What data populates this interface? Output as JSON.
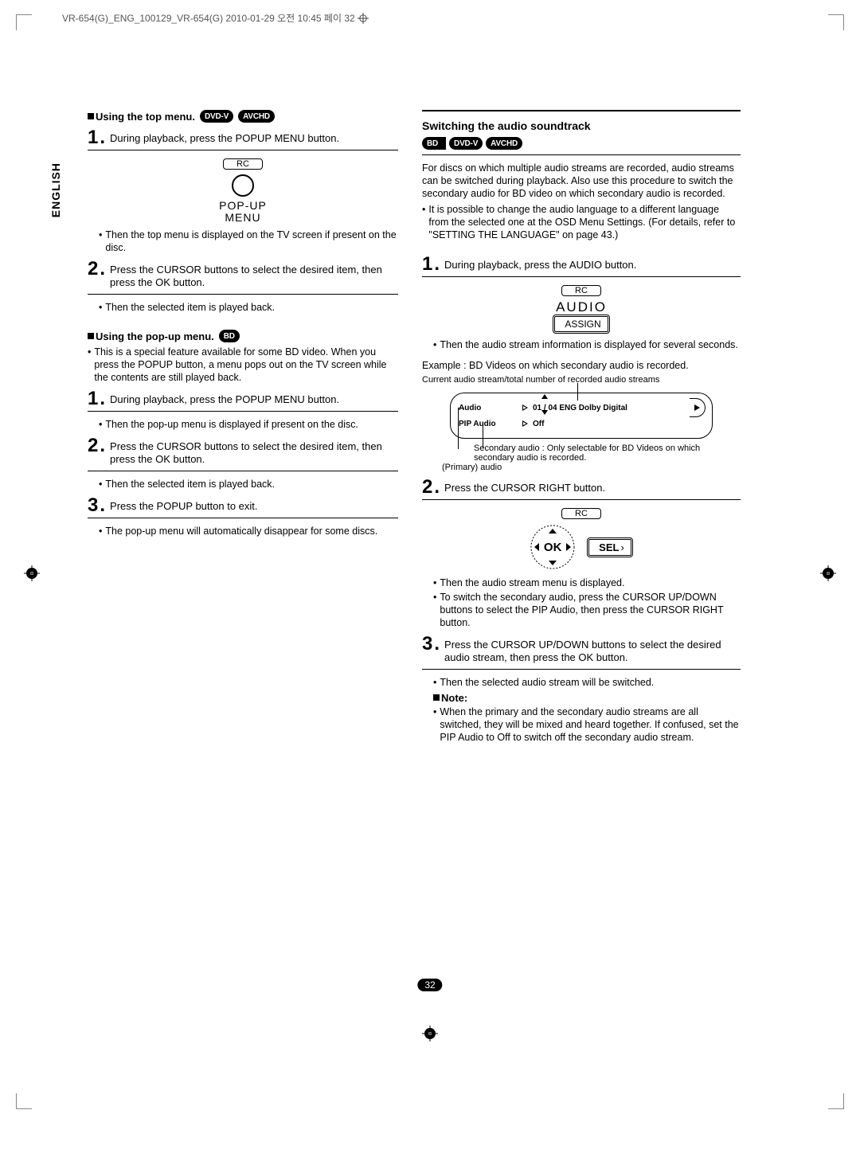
{
  "header": "VR-654(G)_ENG_100129_VR-654(G)  2010-01-29  오전 10:45  페이   32",
  "lang_tab": "ENGLISH",
  "page_number": "32",
  "pills": {
    "bd": "BD",
    "dvdv": "DVD-V",
    "avchd": "AVCHD"
  },
  "rc_label": "RC",
  "left": {
    "s1_title": "Using the top menu.",
    "s1_step1": "During playback, press the POPUP MENU button.",
    "s1_osd": "POP-UP\nMENU",
    "s1_b1": "Then the top menu is displayed on the TV screen if present on the disc.",
    "s1_step2": "Press the CURSOR buttons to select the desired item, then press the OK button.",
    "s1_b2": "Then the selected item is played back.",
    "s2_title": "Using the pop-up menu.",
    "s2_intro": "This is a special feature available for some BD video. When you press the POPUP button, a menu pops out on the TV screen while the contents are still played back.",
    "s2_step1": "During playback, press the POPUP MENU button.",
    "s2_b1": "Then the pop-up menu is displayed if present on the disc.",
    "s2_step2": "Press the CURSOR buttons to select the desired item, then press the OK button.",
    "s2_b2": "Then the selected item is played back.",
    "s2_step3": "Press the POPUP button to exit.",
    "s2_b3": "The pop-up menu will automatically disappear for some discs."
  },
  "right": {
    "title": "Switching the audio soundtrack",
    "intro": "For discs on which multiple audio streams are recorded, audio streams can be switched during playback. Also use this procedure to switch the secondary audio for BD video on which secondary audio is recorded.",
    "intro_b1": "It is possible to change the audio language to a different language from the selected one at the OSD Menu Settings. (For details, refer to \"SETTING THE LANGUAGE\" on page 43.)",
    "step1": "During playback, press the AUDIO button.",
    "osd_audio": "AUDIO",
    "osd_assign": "ASSIGN",
    "step1_b1": "Then the audio stream information is displayed for several seconds.",
    "example": "Example : BD Videos on which secondary audio is recorded.",
    "caption_top": "Current audio stream/total number of recorded audio streams",
    "osd_row1_l": "Audio",
    "osd_row1_r": "01 / 04 ENG Dolby Digital",
    "osd_row2_l": "PIP Audio",
    "osd_row2_r": "Off",
    "caption_primary": "(Primary) audio",
    "caption_secondary": "Secondary audio : Only selectable for BD Videos on which secondary audio is recorded.",
    "step2": "Press the CURSOR RIGHT button.",
    "ok_label": "OK",
    "sel_label": "SEL",
    "step2_b1": "Then the audio stream menu is displayed.",
    "step2_b2": "To switch the secondary audio, press the CURSOR UP/DOWN buttons to select the PIP Audio, then press the CURSOR RIGHT button.",
    "step3": "Press the CURSOR UP/DOWN buttons to select the desired audio stream, then press the OK button.",
    "step3_b1": "Then the selected audio stream will be switched.",
    "note_label": "Note:",
    "note_b1": "When the primary and the secondary audio streams are all switched, they will be mixed and heard together. If confused, set the PIP Audio to Off to switch off the secondary audio stream."
  }
}
